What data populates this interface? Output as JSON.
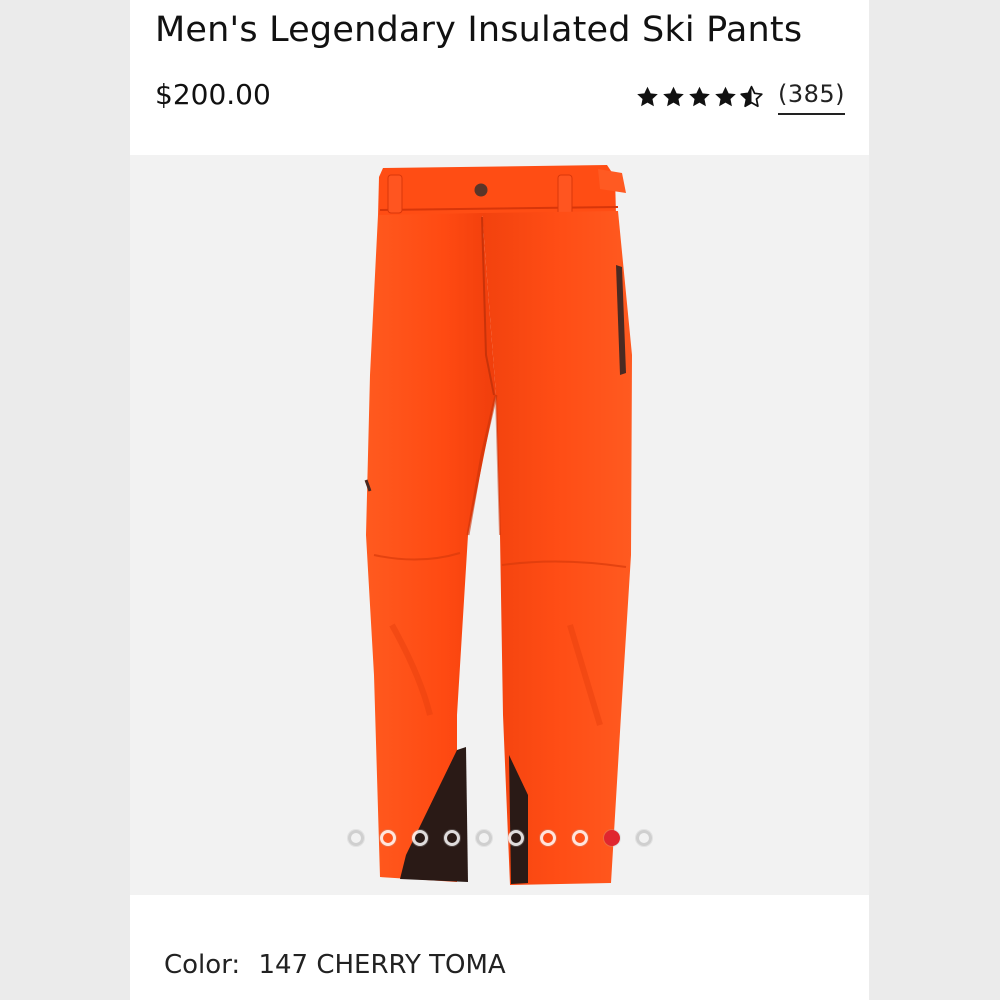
{
  "product": {
    "title": "Men's Legendary Insulated Ski Pants",
    "price": "$200.00",
    "rating": {
      "value": 4.5,
      "max": 5,
      "review_count": "(385)"
    }
  },
  "gallery": {
    "image_count": 10,
    "active_index": 8,
    "product_color": "#ff4a12",
    "accent_color": "#e0262f"
  },
  "color_selector": {
    "label": "Color:",
    "value": "147 CHERRY TOMA"
  },
  "icons": [
    "star-icon",
    "half-star-icon"
  ]
}
